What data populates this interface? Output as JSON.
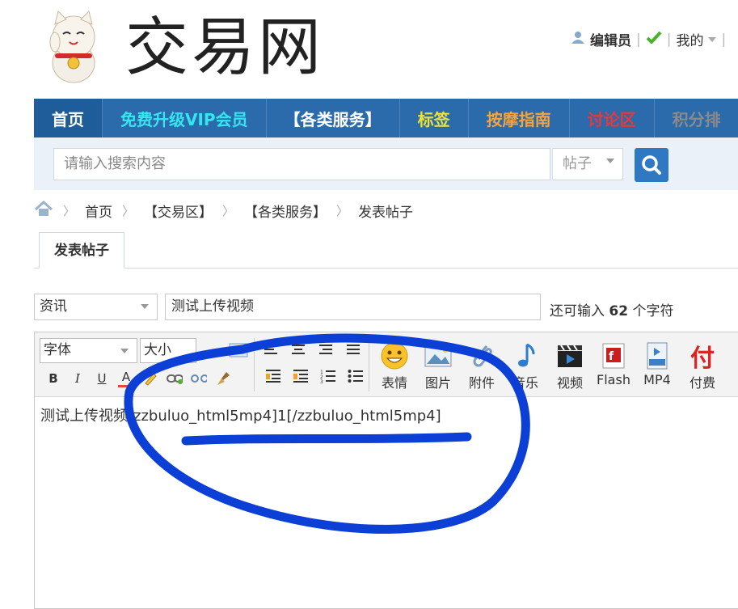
{
  "header": {
    "site_title": "交易网",
    "user_role": "编辑员",
    "my_label": "我的"
  },
  "nav": [
    {
      "label": "首页",
      "color": "#ffffff"
    },
    {
      "label": "免费升级VIP会员",
      "color": "#35e6f0"
    },
    {
      "label": "【各类服务】",
      "color": "#ffffff"
    },
    {
      "label": "标签",
      "color": "#f0e03a"
    },
    {
      "label": "按摩指南",
      "color": "#f4a43a"
    },
    {
      "label": "讨论区",
      "color": "#e8383a"
    },
    {
      "label": "积分排",
      "color": "#8a8a8a"
    }
  ],
  "search": {
    "placeholder": "请输入搜索内容",
    "type": "帖子"
  },
  "breadcrumb": [
    "首页",
    "【交易区】",
    "【各类服务】",
    "发表帖子"
  ],
  "tab": "发表帖子",
  "post": {
    "category": "资讯",
    "title": "测试上传视频",
    "remain_prefix": "还可输入",
    "remain_count": "62",
    "remain_suffix": "个字符"
  },
  "editor": {
    "font_label": "字体",
    "size_label": "大小",
    "tools": [
      "表情",
      "图片",
      "附件",
      "音乐",
      "视频",
      "Flash",
      "MP4",
      "付费"
    ],
    "content": "测试上传视频[zzbuluo_html5mp4]1[/zzbuluo_html5mp4]"
  },
  "colors": {
    "nav_bg": "#2b6bab",
    "annotation": "#0b3fd6",
    "search_btn": "#2e79c2"
  }
}
